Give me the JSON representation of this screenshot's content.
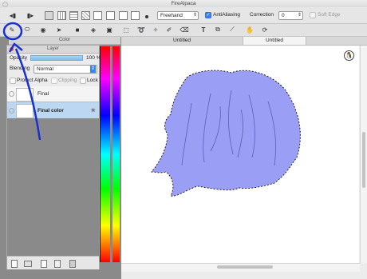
{
  "window": {
    "title": "FireAlpaca"
  },
  "toolbar": {
    "brush_mode": "Freehand",
    "antialiasing_label": "AntiAliasing",
    "antialiasing_checked": true,
    "correction_label": "Correction",
    "correction_value": "0",
    "soft_edge_label": "Soft Edge",
    "soft_edge_checked": false
  },
  "tabs": [
    {
      "label": "Untitled"
    },
    {
      "label": "Untitled"
    }
  ],
  "color_panel": {
    "title": "Color"
  },
  "layer_panel": {
    "title": "Layer",
    "opacity_label": "Opacity",
    "opacity_value": "100 %",
    "blending_label": "Blending",
    "blending_value": "Normal",
    "protect_alpha_label": "Protect Alpha",
    "clipping_label": "Clipping",
    "lock_label": "Lock",
    "layers": [
      {
        "name": "Final",
        "selected": false
      },
      {
        "name": "Final color",
        "selected": true
      }
    ]
  },
  "colors": {
    "selection_fill": "#9a9ef5",
    "selected_layer": "#bcd7f2",
    "annotation": "#1a2fd0"
  }
}
